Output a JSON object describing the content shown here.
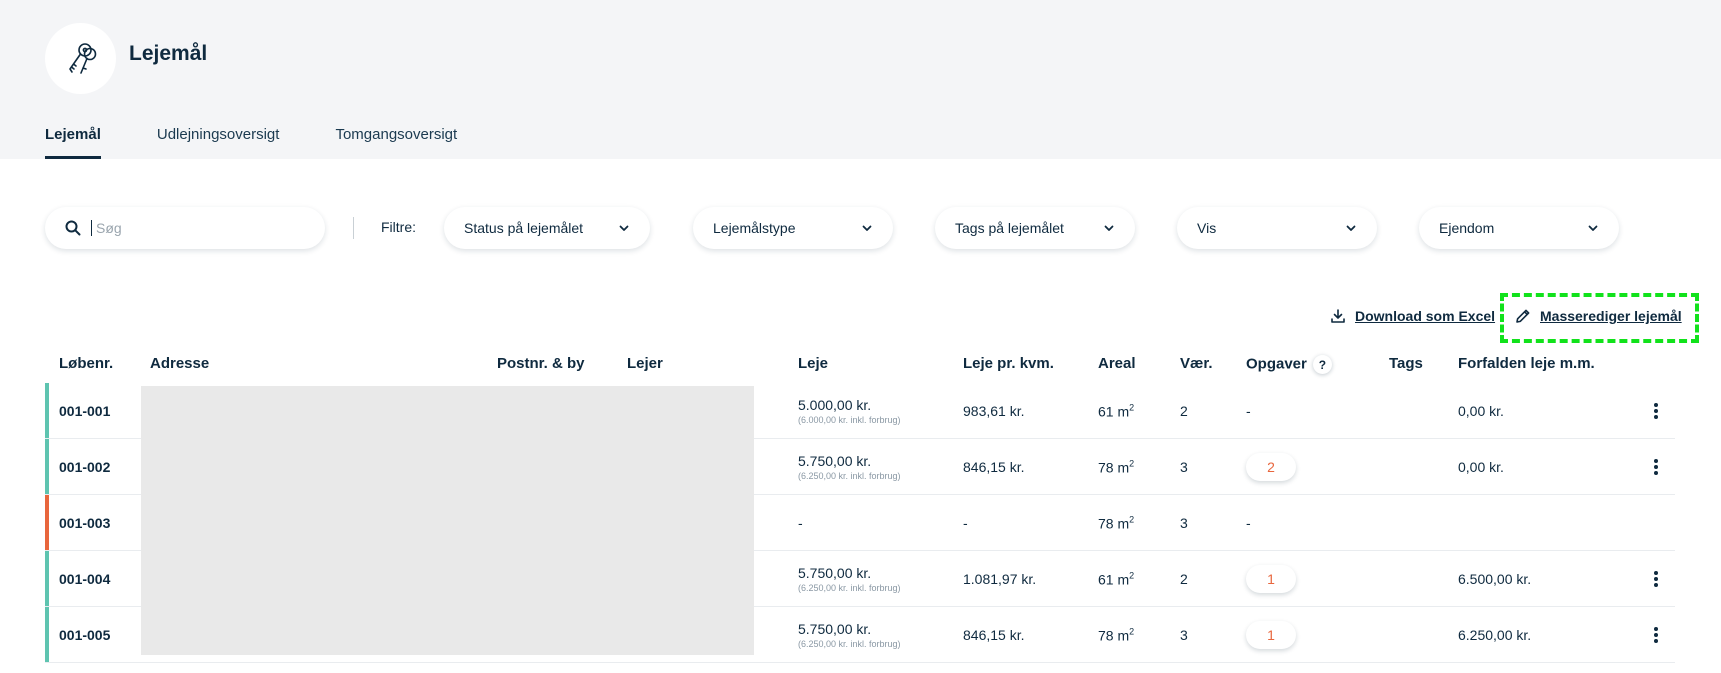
{
  "header": {
    "title": "Lejemål",
    "logo_icon": "keys-icon"
  },
  "tabs": [
    {
      "label": "Lejemål",
      "active": true
    },
    {
      "label": "Udlejningsoversigt",
      "active": false
    },
    {
      "label": "Tomgangsoversigt",
      "active": false
    }
  ],
  "search": {
    "placeholder": "Søg",
    "value": ""
  },
  "filters": {
    "label": "Filtre:",
    "dropdowns": [
      "Status på lejemålet",
      "Lejemålstype",
      "Tags på lejemålet",
      "Vis",
      "Ejendom"
    ]
  },
  "actions": {
    "download_label": "Download som Excel",
    "mass_edit_label": "Masserediger lejemål"
  },
  "table": {
    "headers": {
      "number": "Løbenr.",
      "address": "Adresse",
      "postal": "Postnr. & by",
      "tenant": "Lejer",
      "rent": "Leje",
      "rent_sqm": "Leje pr. kvm.",
      "area": "Areal",
      "rooms": "Vær.",
      "tasks": "Opgaver",
      "tasks_help": "?",
      "tags": "Tags",
      "overdue": "Forfalden leje m.m."
    },
    "rows": [
      {
        "number": "001-001",
        "status_color": "#5ec4b0",
        "rent": "5.000,00 kr.",
        "rent_sub": "(6.000,00 kr. inkl. forbrug)",
        "rent_sqm": "983,61 kr.",
        "area": "61 m",
        "area_unit_sup": "2",
        "rooms": "2",
        "tasks": "-",
        "tasks_badge": false,
        "overdue": "0,00 kr.",
        "menu": true
      },
      {
        "number": "001-002",
        "status_color": "#5ec4b0",
        "rent": "5.750,00 kr.",
        "rent_sub": "(6.250,00 kr. inkl. forbrug)",
        "rent_sqm": "846,15 kr.",
        "area": "78 m",
        "area_unit_sup": "2",
        "rooms": "3",
        "tasks": "2",
        "tasks_badge": true,
        "overdue": "0,00 kr.",
        "menu": true
      },
      {
        "number": "001-003",
        "status_color": "#e8663d",
        "rent": "-",
        "rent_sub": "",
        "rent_sqm": "-",
        "area": "78 m",
        "area_unit_sup": "2",
        "rooms": "3",
        "tasks": "-",
        "tasks_badge": false,
        "overdue": "",
        "menu": false
      },
      {
        "number": "001-004",
        "status_color": "#5ec4b0",
        "rent": "5.750,00 kr.",
        "rent_sub": "(6.250,00 kr. inkl. forbrug)",
        "rent_sqm": "1.081,97 kr.",
        "area": "61 m",
        "area_unit_sup": "2",
        "rooms": "2",
        "tasks": "1",
        "tasks_badge": true,
        "overdue": "6.500,00 kr.",
        "menu": true
      },
      {
        "number": "001-005",
        "status_color": "#5ec4b0",
        "rent": "5.750,00 kr.",
        "rent_sub": "(6.250,00 kr. inkl. forbrug)",
        "rent_sqm": "846,15 kr.",
        "area": "78 m",
        "area_unit_sup": "2",
        "rooms": "3",
        "tasks": "1",
        "tasks_badge": true,
        "overdue": "6.250,00 kr.",
        "menu": true
      }
    ]
  },
  "colors": {
    "text": "#0f2a3f",
    "status_active": "#5ec4b0",
    "status_vacant": "#e8663d",
    "task_badge": "#e8663d",
    "highlight": "#11e21b"
  }
}
